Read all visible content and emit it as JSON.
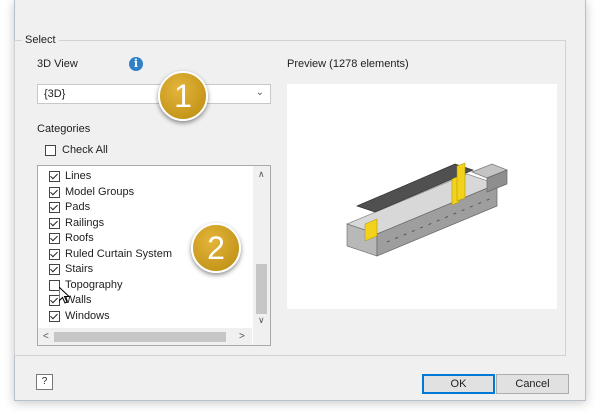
{
  "select_group": {
    "title": "Select"
  },
  "view": {
    "label": "3D View",
    "info_glyph": "i",
    "selected": "{3D}",
    "dropdown_glyph": "⌄"
  },
  "preview": {
    "label": "Preview (1278 elements)"
  },
  "categories": {
    "label": "Categories",
    "check_all_label": "Check All",
    "check_all_checked": false,
    "items": [
      {
        "label": "Lines",
        "checked": true
      },
      {
        "label": "Model Groups",
        "checked": true
      },
      {
        "label": "Pads",
        "checked": true
      },
      {
        "label": "Railings",
        "checked": true
      },
      {
        "label": "Roofs",
        "checked": true
      },
      {
        "label": "Ruled Curtain System",
        "checked": true
      },
      {
        "label": "Stairs",
        "checked": true
      },
      {
        "label": "Topography",
        "checked": false
      },
      {
        "label": "Walls",
        "checked": true
      },
      {
        "label": "Windows",
        "checked": true
      }
    ],
    "scroll_glyphs": {
      "up": "∧",
      "down": "∨",
      "left": "<",
      "right": ">"
    }
  },
  "callouts": [
    {
      "number": "1"
    },
    {
      "number": "2"
    }
  ],
  "footer": {
    "help_glyph": "?",
    "ok_label": "OK",
    "cancel_label": "Cancel"
  },
  "colors": {
    "badge": "#c89b1b",
    "info_icon": "#2f80c9",
    "ok_border": "#0078d7",
    "model_accent": "#f2d21a"
  }
}
